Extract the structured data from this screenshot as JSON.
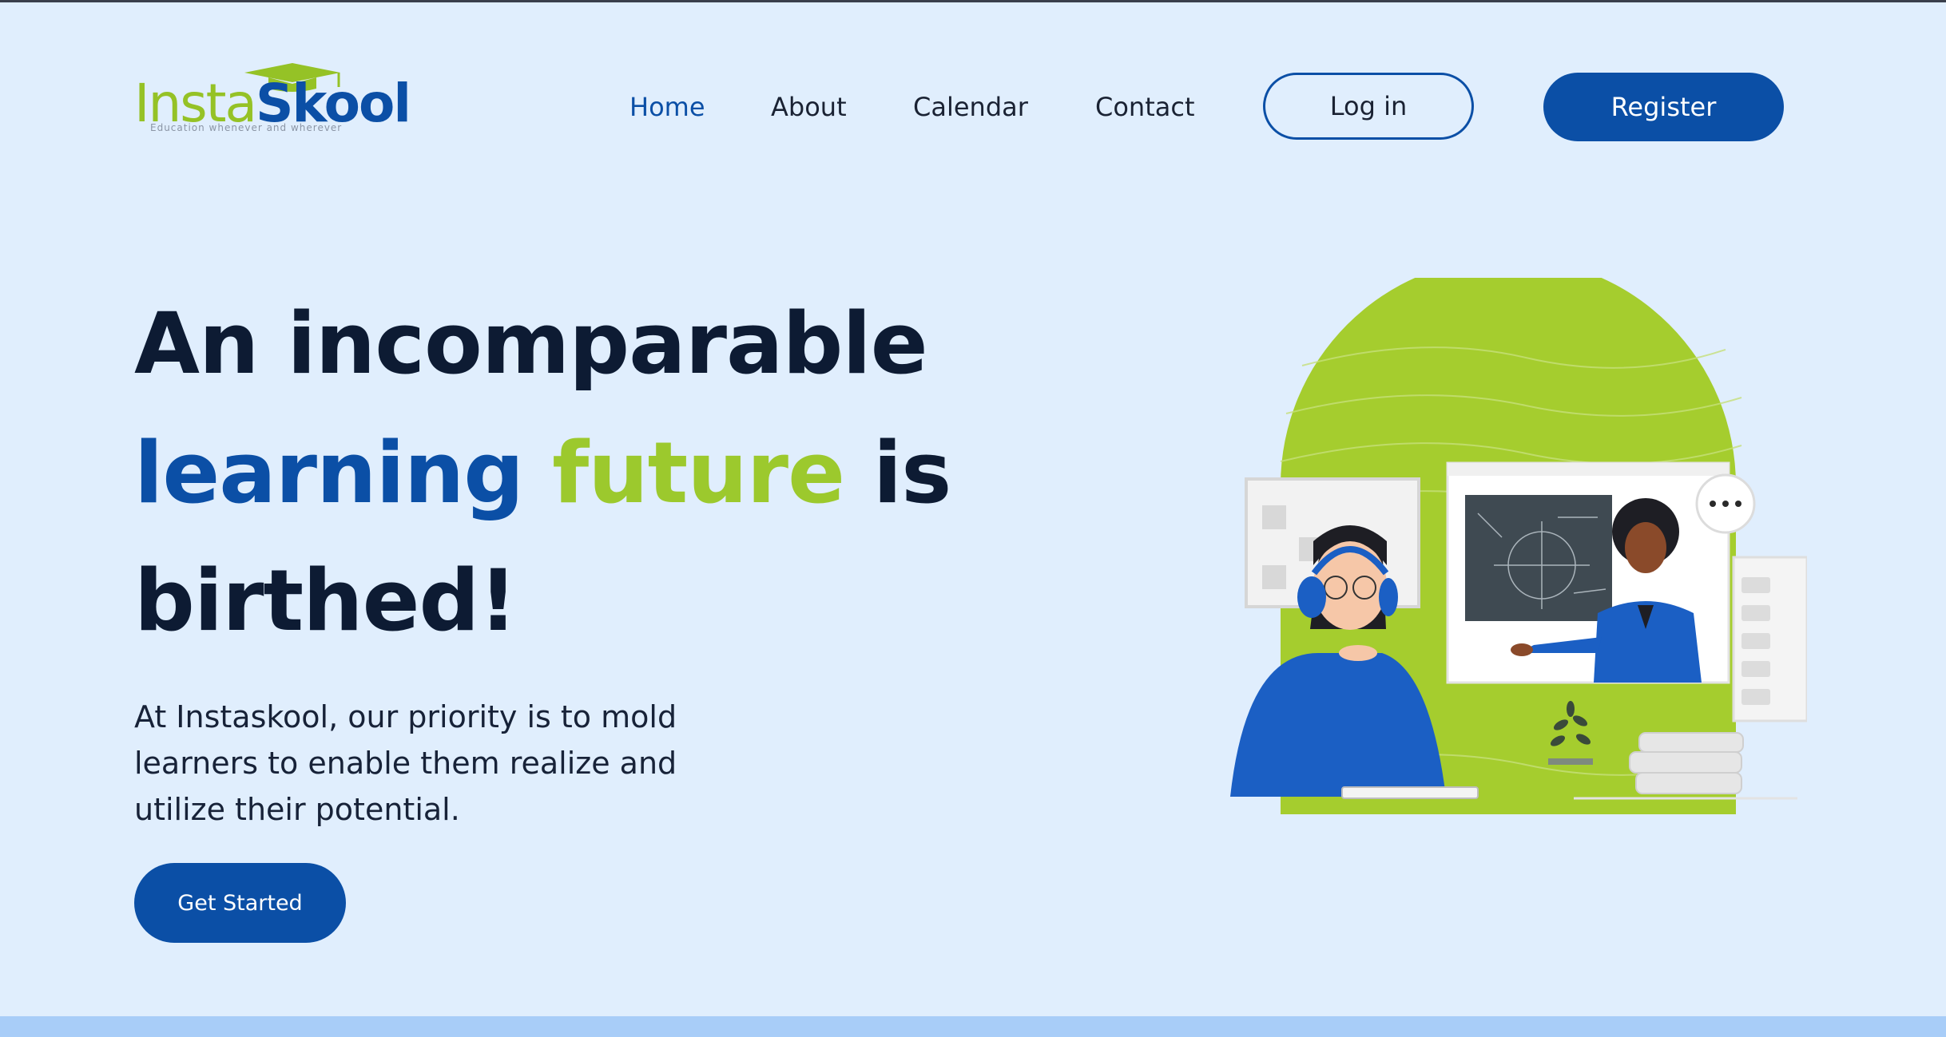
{
  "brand": {
    "name_part1": "Insta",
    "name_part2": "Skool",
    "tagline": "Education whenever and wherever"
  },
  "nav": {
    "items": [
      {
        "label": "Home",
        "active": true
      },
      {
        "label": "About",
        "active": false
      },
      {
        "label": "Calendar",
        "active": false
      },
      {
        "label": "Contact",
        "active": false
      }
    ],
    "login_label": "Log in",
    "register_label": "Register"
  },
  "hero": {
    "line1": "An incomparable",
    "line2_blue": "learning",
    "line2_green": "future",
    "line2_rest": "is",
    "line3": "birthed!",
    "description_lines": [
      "At Instaskool, our priority is to mold",
      "learners to enable them realize and",
      "utilize their potential."
    ],
    "cta_label": "Get Started"
  },
  "colors": {
    "background": "#e0eefd",
    "brand_blue": "#0b4fa6",
    "brand_green": "#9cc92d",
    "heading": "#0d1b33"
  }
}
